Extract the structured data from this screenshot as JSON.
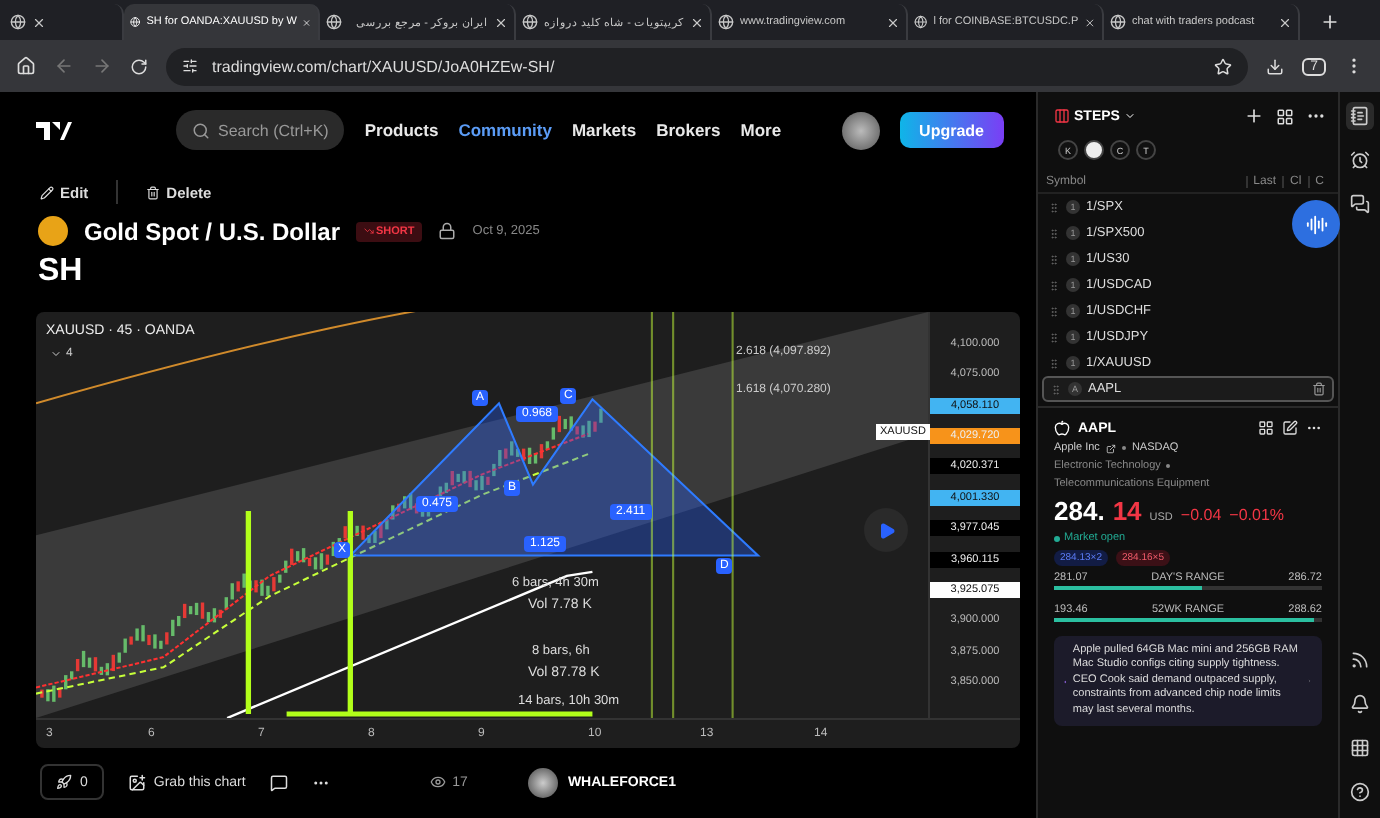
{
  "browser": {
    "tabs": [
      {
        "selected": false
      },
      {
        "title": "SH for OANDA:XAUUSD by W",
        "selected": true
      },
      {
        "title": "ایران بروکر - مرجع بررسی",
        "selected": false
      },
      {
        "title": "کریپتویات - شاه کلید دروازه",
        "selected": false
      },
      {
        "title": "www.tradingview.com",
        "selected": false
      },
      {
        "title": "l for COINBASE:BTCUSDC.P",
        "selected": false
      },
      {
        "title": "chat with traders podcast",
        "selected": false
      }
    ],
    "url": "tradingview.com/chart/XAUUSD/JoA0HZEw-SH/",
    "extension_badge": "7"
  },
  "site_header": {
    "search_placeholder": "Search (Ctrl+K)",
    "nav": [
      {
        "label": "Products",
        "selected": false
      },
      {
        "label": "Community",
        "selected": true
      },
      {
        "label": "Markets",
        "selected": false
      },
      {
        "label": "Brokers",
        "selected": false
      },
      {
        "label": "More",
        "selected": false
      }
    ],
    "upgrade": "Upgrade"
  },
  "post": {
    "actions": [
      {
        "kind": "edit",
        "label": "Edit"
      },
      {
        "kind": "delete",
        "label": "Delete"
      }
    ],
    "symbol_name": "Gold Spot / U.S. Dollar",
    "direction": "SHORT",
    "date": "Oct 9, 2025",
    "title": "SH"
  },
  "chart": {
    "legend": "XAUUSD · 45 · OANDA",
    "indicators": "4",
    "symbol_tag": "XAUUSD",
    "price_labels": [
      {
        "text": "4,100.000",
        "kind": "plain"
      },
      {
        "text": "4,075.000",
        "kind": "plain"
      },
      {
        "text": "4,058.110",
        "kind": "tag",
        "color": "#42b4f2"
      },
      {
        "text": "4,029.720",
        "kind": "tag",
        "color": "#f7931a"
      },
      {
        "text": "4,020.371",
        "kind": "tag",
        "color": "#000000"
      },
      {
        "text": "4,001.330",
        "kind": "tag",
        "color": "#42b4f2"
      },
      {
        "text": "3,977.045",
        "kind": "tag",
        "color": "#000000"
      },
      {
        "text": "3,960.115",
        "kind": "tag",
        "color": "#000000"
      },
      {
        "text": "3,925.075",
        "kind": "tag",
        "color": "#ffffff"
      },
      {
        "text": "3,900.000",
        "kind": "plain"
      },
      {
        "text": "3,875.000",
        "kind": "plain"
      },
      {
        "text": "3,850.000",
        "kind": "plain"
      }
    ],
    "time_labels": [
      "3",
      "6",
      "7",
      "8",
      "9",
      "10",
      "13",
      "14"
    ],
    "fib_levels": [
      "2.618 (4,097.892)",
      "1.618 (4,070.280)"
    ],
    "points": [
      "A",
      "C",
      "B",
      "X",
      "D"
    ],
    "ratios": [
      "0.968",
      "0.475",
      "2.411",
      "1.125"
    ],
    "measures": [
      "6 bars, 4h 30m",
      "Vol 7.78 K",
      "8 bars, 6h",
      "Vol 87.78 K",
      "14 bars, 10h 30m"
    ]
  },
  "footer": {
    "boosts": "0",
    "grab": "Grab this chart",
    "views": "17",
    "author": "WHALEFORCE1"
  },
  "watchlist": {
    "name": "STEPS",
    "chips": [
      {
        "label": "K",
        "kind": "letter"
      },
      {
        "kind": "logo"
      },
      {
        "label": "C",
        "kind": "letter"
      },
      {
        "label": "T",
        "kind": "letter"
      }
    ],
    "columns": [
      "Symbol",
      "Last",
      "Cl",
      "C"
    ],
    "rows": [
      {
        "badge": "1",
        "symbol": "1/SPX",
        "selected": false
      },
      {
        "badge": "1",
        "symbol": "1/SPX500",
        "selected": false
      },
      {
        "badge": "1",
        "symbol": "1/US30",
        "selected": false
      },
      {
        "badge": "1",
        "symbol": "1/USDCAD",
        "selected": false
      },
      {
        "badge": "1",
        "symbol": "1/USDCHF",
        "selected": false
      },
      {
        "badge": "1",
        "symbol": "1/USDJPY",
        "selected": false
      },
      {
        "badge": "1",
        "symbol": "1/XAUUSD",
        "selected": false
      },
      {
        "badge": "A",
        "symbol": "AAPL",
        "selected": true
      }
    ]
  },
  "details": {
    "symbol": "AAPL",
    "company": "Apple Inc",
    "exchange": "NASDAQ",
    "sector": "Electronic Technology",
    "industry": "Telecommunications Equipment",
    "price_main": "284.",
    "price_last": "14",
    "currency": "USD",
    "change": "−0.04",
    "change_pct": "−0.01%",
    "status": "Market open",
    "bid": "284.13×2",
    "ask": "284.16×5",
    "ranges": [
      {
        "low": "281.07",
        "label": "DAY'S RANGE",
        "high": "286.72",
        "level": 0.55
      },
      {
        "low": "193.46",
        "label": "52WK RANGE",
        "high": "288.62",
        "level": 0.97
      }
    ],
    "news": "Apple pulled 64GB Mac mini and 256GB RAM Mac Studio configs citing supply tightness. CEO Cook said demand outpaced supply, constraints from advanced chip node limits may last several months."
  }
}
